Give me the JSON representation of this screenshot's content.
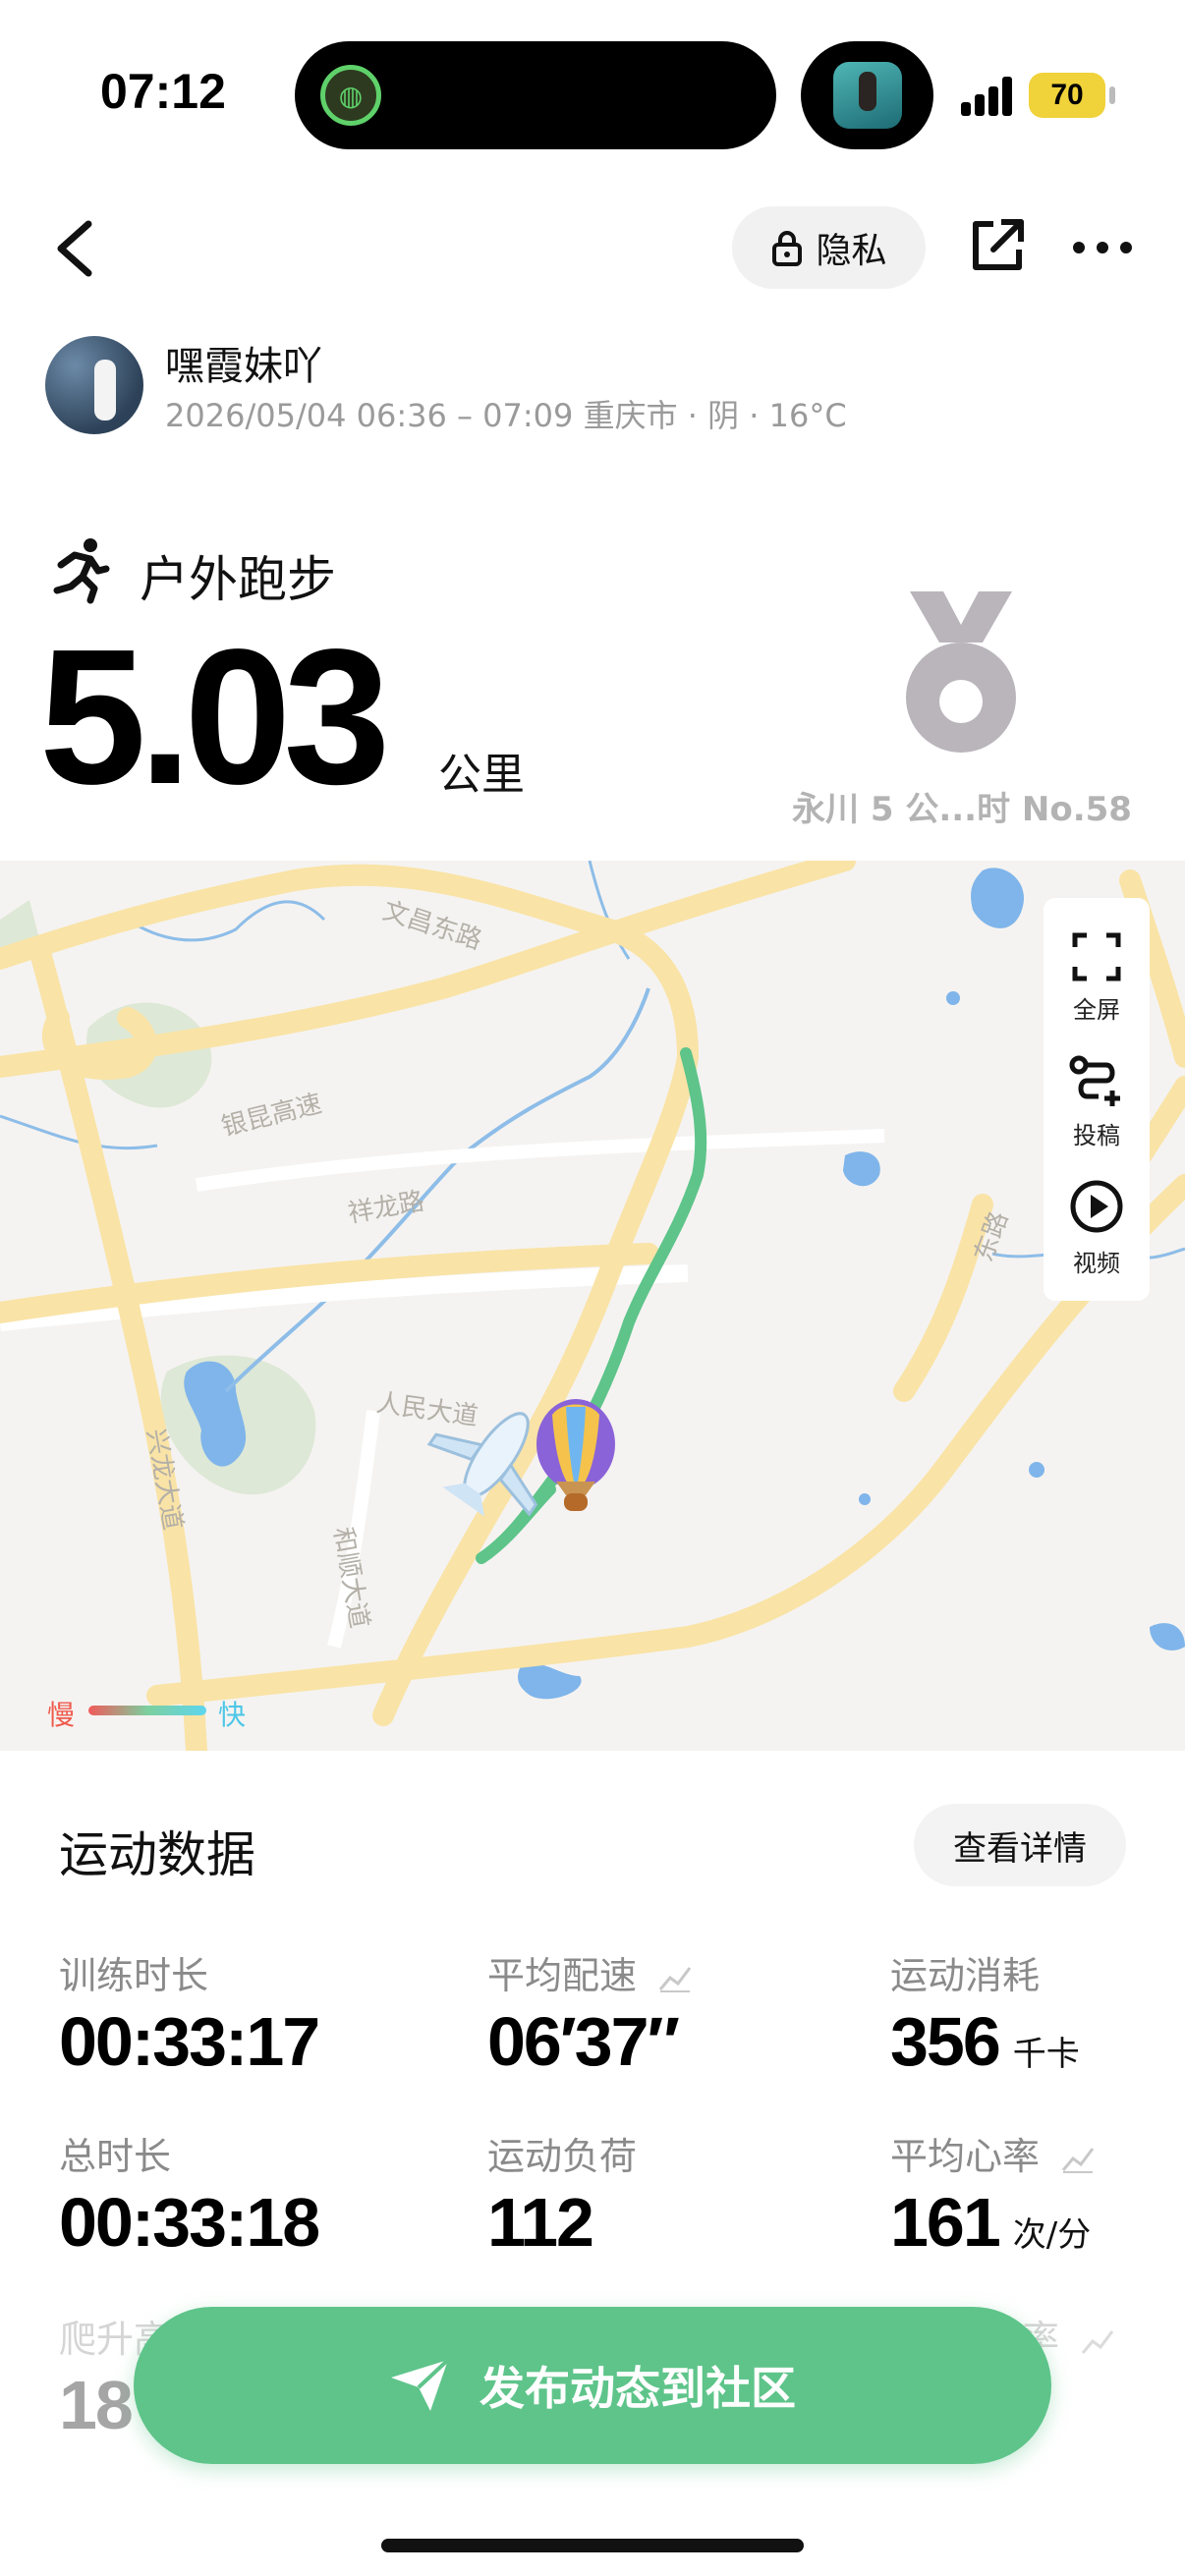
{
  "status_bar": {
    "time": "07:12",
    "battery": "70",
    "battery_color": "#f0d23a"
  },
  "nav": {
    "privacy_label": "隐私",
    "back_icon": "chevron-left-icon",
    "share_icon": "share-icon",
    "more_icon": "more-icon"
  },
  "user": {
    "name": "嘿霞妹吖",
    "meta": "2026/05/04 06:36 – 07:09 重庆市 · 阴 · 16°C"
  },
  "activity": {
    "name": "户外跑步",
    "distance": "5.03",
    "unit": "公里",
    "medal_label": "永川 5 公...时 No.58"
  },
  "map": {
    "roads": [
      "文昌东路",
      "银昆高速",
      "祥龙路",
      "人民大道",
      "兴龙大道",
      "和顺大道",
      "东路"
    ],
    "tools": [
      {
        "label": "全屏",
        "icon": "fullscreen-icon"
      },
      {
        "label": "投稿",
        "icon": "route-submit-icon"
      },
      {
        "label": "视频",
        "icon": "play-video-icon"
      }
    ],
    "legend": {
      "slow": "慢",
      "fast": "快"
    },
    "route_color": "#5ec48a"
  },
  "data_section": {
    "title": "运动数据",
    "details_label": "查看详情",
    "stats": [
      {
        "label": "训练时长",
        "value": "00:33:17",
        "unit": ""
      },
      {
        "label": "平均配速",
        "value": "06′37″",
        "unit": ""
      },
      {
        "label": "运动消耗",
        "value": "356",
        "unit": "千卡"
      },
      {
        "label": "总时长",
        "value": "00:33:18",
        "unit": ""
      },
      {
        "label": "运动负荷",
        "value": "112",
        "unit": ""
      },
      {
        "label": "平均心率",
        "value": "161",
        "unit": "次/分"
      },
      {
        "label": "爬升高",
        "value": "18",
        "unit": ""
      },
      {
        "label": "率",
        "value": "",
        "unit": ""
      }
    ]
  },
  "publish": {
    "label": "发布动态到社区",
    "color": "#5ec48a"
  }
}
